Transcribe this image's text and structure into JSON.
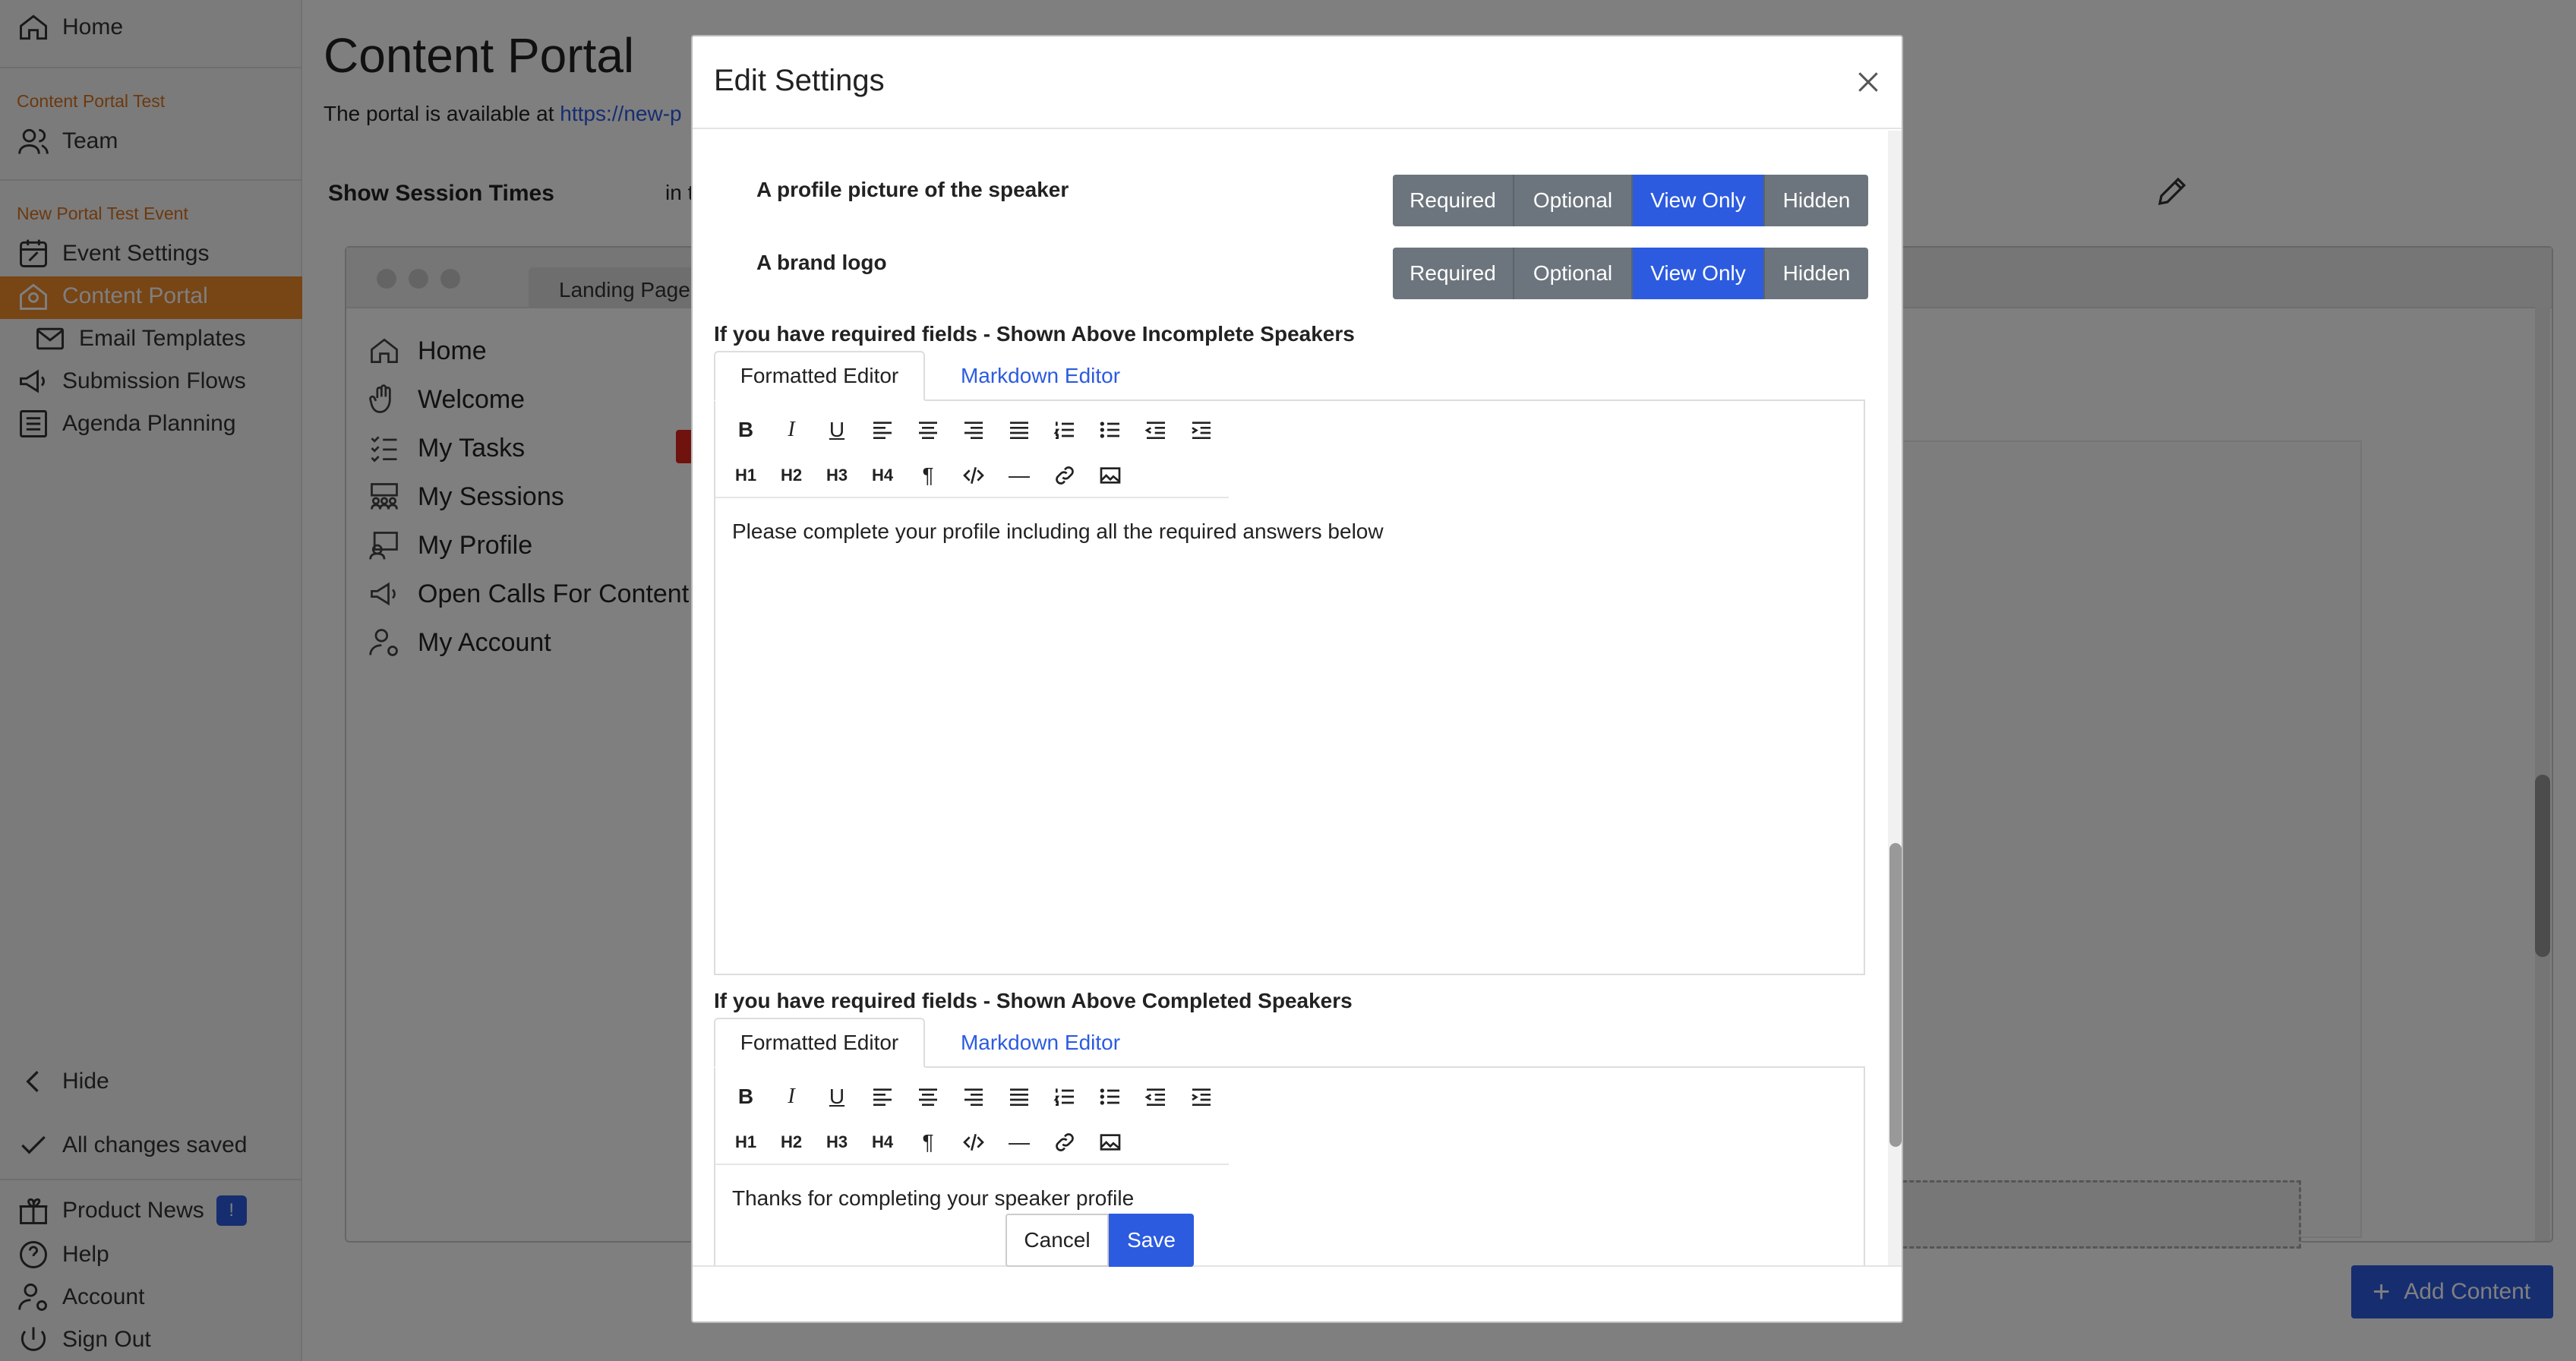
{
  "sidebar": {
    "home": "Home",
    "section1": "Content Portal Test",
    "team": "Team",
    "section2": "New Portal Test Event",
    "items": [
      {
        "label": "Event Settings"
      },
      {
        "label": "Content Portal"
      },
      {
        "label": "Email Templates"
      },
      {
        "label": "Submission Flows"
      },
      {
        "label": "Agenda Planning"
      }
    ],
    "hide": "Hide",
    "saved": "All changes saved",
    "product_news": "Product News",
    "news_badge": "!",
    "help": "Help",
    "account": "Account",
    "sign_out": "Sign Out"
  },
  "main": {
    "title": "Content Portal",
    "portal_text": "The portal is available at",
    "portal_link": "https://new-p",
    "show_session_times": "Show Session Times",
    "in_text": "in t",
    "preview": {
      "tab": "Landing Page",
      "nav": [
        "Home",
        "Welcome",
        "My Tasks",
        "My Sessions",
        "My Profile",
        "Open Calls For Content",
        "My Account"
      ]
    },
    "add_content": "Add Content"
  },
  "modal": {
    "title": "Edit Settings",
    "fields": [
      {
        "label": "A profile picture of the speaker",
        "options": [
          "Required",
          "Optional",
          "View Only",
          "Hidden"
        ],
        "selected": "View Only"
      },
      {
        "label": "A brand logo",
        "options": [
          "Required",
          "Optional",
          "View Only",
          "Hidden"
        ],
        "selected": "View Only"
      }
    ],
    "section_incomplete": {
      "title": "If you have required fields - Shown Above Incomplete Speakers",
      "tab_formatted": "Formatted Editor",
      "tab_markdown": "Markdown Editor",
      "text": "Please complete your profile including all the required answers below"
    },
    "section_completed": {
      "title": "If you have required fields - Shown Above Completed Speakers",
      "tab_formatted": "Formatted Editor",
      "tab_markdown": "Markdown Editor",
      "text": "Thanks for completing your speaker profile"
    },
    "toolbar_headings": [
      "H1",
      "H2",
      "H3",
      "H4"
    ],
    "cancel": "Cancel",
    "save": "Save"
  },
  "colors": {
    "accent": "#2c5be0",
    "sidebar_active": "#f08a2b",
    "segment_inactive": "#6c757d"
  }
}
